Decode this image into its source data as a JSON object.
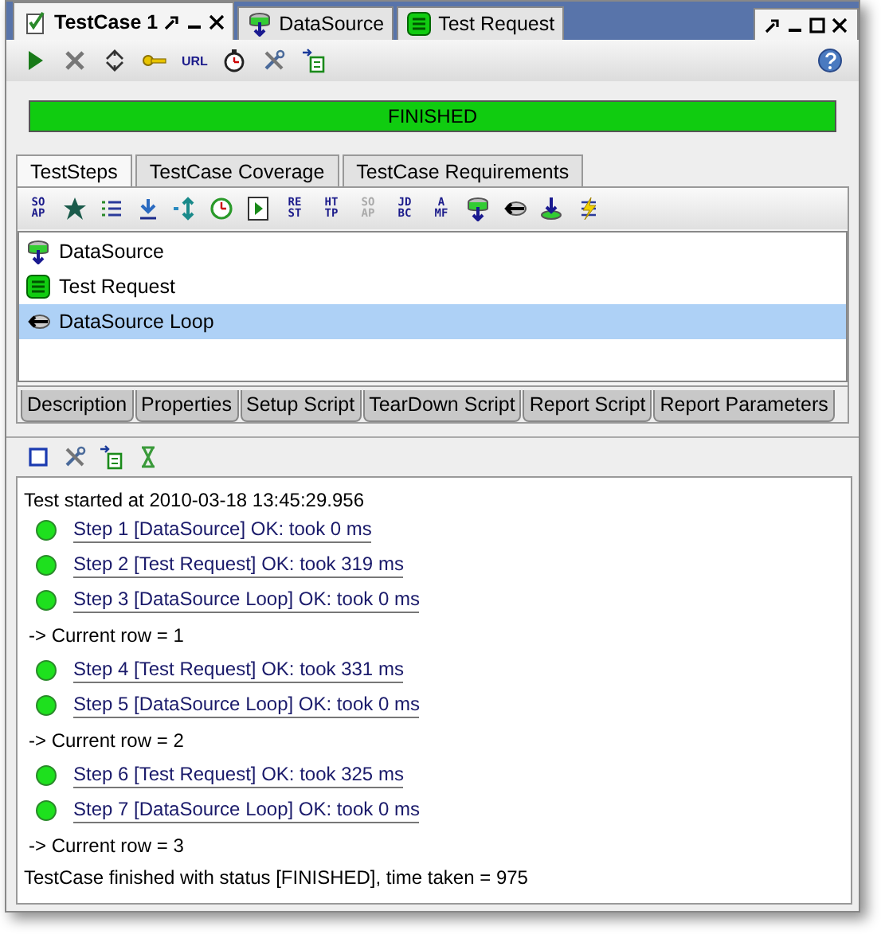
{
  "doc_tabs": [
    {
      "label": "TestCase 1",
      "selected": true,
      "kind": "testcase"
    },
    {
      "label": "DataSource",
      "selected": false,
      "kind": "datasource"
    },
    {
      "label": "Test Request",
      "selected": false,
      "kind": "soap"
    }
  ],
  "toolbar": [
    {
      "kind": "run"
    },
    {
      "kind": "cancel"
    },
    {
      "kind": "loop"
    },
    {
      "kind": "key"
    },
    {
      "kind": "text",
      "label": "URL"
    },
    {
      "kind": "timer"
    },
    {
      "kind": "tools"
    },
    {
      "kind": "export"
    },
    {
      "kind": "help"
    }
  ],
  "progress": {
    "label": "FINISHED",
    "level": 1
  },
  "tabs": [
    {
      "label": "TestSteps",
      "selected": true
    },
    {
      "label": "TestCase Coverage",
      "selected": false
    },
    {
      "label": "TestCase Requirements",
      "selected": false
    }
  ],
  "step_toolbar": [
    {
      "kind": "glyph",
      "lines": [
        "SO",
        "AP"
      ],
      "disabled": false
    },
    {
      "kind": "star"
    },
    {
      "kind": "list"
    },
    {
      "kind": "download"
    },
    {
      "kind": "arrows"
    },
    {
      "kind": "clock"
    },
    {
      "kind": "gobox"
    },
    {
      "kind": "glyph",
      "lines": [
        "RE",
        "ST"
      ],
      "disabled": false
    },
    {
      "kind": "glyph",
      "lines": [
        "HT",
        "TP"
      ],
      "disabled": false
    },
    {
      "kind": "glyph",
      "lines": [
        "SO",
        "AP"
      ],
      "disabled": true
    },
    {
      "kind": "glyph",
      "lines": [
        "JD",
        "BC"
      ],
      "disabled": false
    },
    {
      "kind": "glyph",
      "lines": [
        "A",
        "MF"
      ],
      "disabled": false
    },
    {
      "kind": "datasource"
    },
    {
      "kind": "loopback"
    },
    {
      "kind": "datasink"
    },
    {
      "kind": "lightning"
    }
  ],
  "steps": [
    {
      "label": "DataSource",
      "kind": "datasource",
      "selected": false
    },
    {
      "label": "Test Request",
      "kind": "soap",
      "selected": false
    },
    {
      "label": "DataSource Loop",
      "kind": "loopback",
      "selected": true
    }
  ],
  "bottom_tabs": [
    "Description",
    "Properties",
    "Setup Script",
    "TearDown Script",
    "Report Script",
    "Report Parameters"
  ],
  "log_toolbar": [
    {
      "kind": "square"
    },
    {
      "kind": "tools"
    },
    {
      "kind": "export"
    },
    {
      "kind": "hourglass"
    }
  ],
  "log": [
    {
      "kind": "text",
      "text": "Test started at 2010-03-18 13:45:29.956"
    },
    {
      "kind": "step",
      "text": "Step 1 [DataSource] OK: took 0 ms"
    },
    {
      "kind": "step",
      "text": "Step 2 [Test Request] OK: took 319 ms"
    },
    {
      "kind": "step",
      "text": "Step 3 [DataSource Loop] OK: took 0 ms"
    },
    {
      "kind": "row",
      "text": "-> Current row = 1"
    },
    {
      "kind": "step",
      "text": "Step 4 [Test Request] OK: took 331 ms"
    },
    {
      "kind": "step",
      "text": "Step 5 [DataSource Loop] OK: took 0 ms"
    },
    {
      "kind": "row",
      "text": "-> Current row = 2"
    },
    {
      "kind": "step",
      "text": "Step 6 [Test Request] OK: took 325 ms"
    },
    {
      "kind": "step",
      "text": "Step 7 [DataSource Loop] OK: took 0 ms"
    },
    {
      "kind": "row",
      "text": "-> Current row = 3"
    },
    {
      "kind": "text",
      "text": "TestCase finished with status [FINISHED], time taken = 975"
    }
  ]
}
